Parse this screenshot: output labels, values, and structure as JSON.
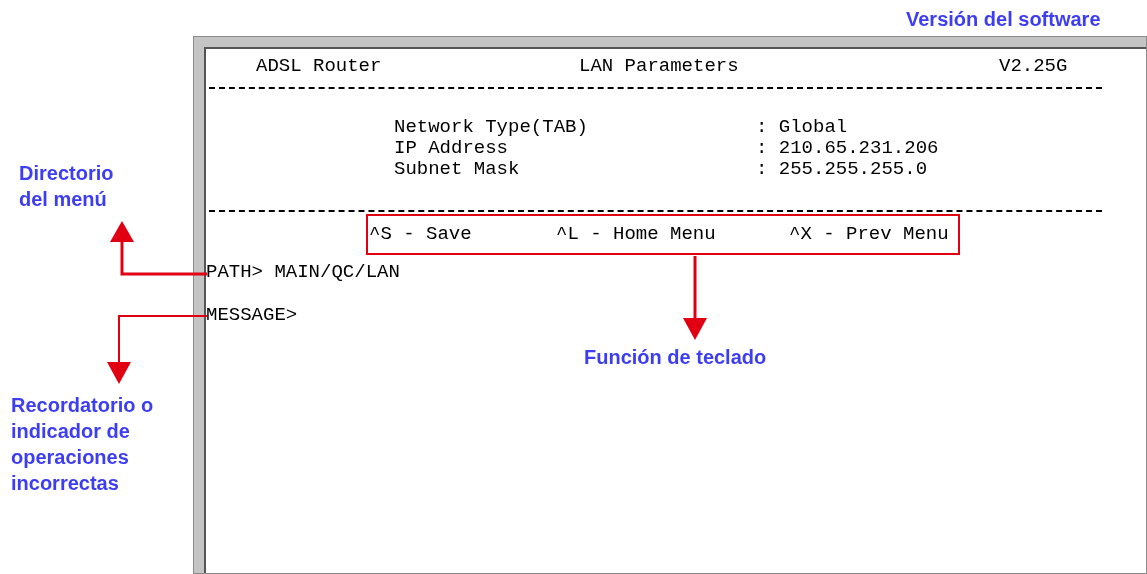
{
  "terminal": {
    "app": "ADSL Router",
    "title": "LAN Parameters",
    "version": "V2.25G"
  },
  "fields": [
    {
      "label": "Network Type(TAB)",
      "value": ": Global"
    },
    {
      "label": "IP Address",
      "value": ": 210.65.231.206"
    },
    {
      "label": "Subnet Mask",
      "value": ": 255.255.255.0"
    }
  ],
  "shortcuts": [
    "^S - Save",
    "^L - Home Menu",
    "^X - Prev Menu"
  ],
  "path": "PATH> MAIN/QC/LAN",
  "message_prompt": "MESSAGE>",
  "annotations": [
    {
      "kind": "version",
      "text": "Versión del software"
    },
    {
      "kind": "path",
      "text": "Directorio del menú"
    },
    {
      "kind": "keys",
      "text": "Función de teclado"
    },
    {
      "kind": "message",
      "text": "Recordatorio o indicador de operaciones incorrectas"
    }
  ]
}
